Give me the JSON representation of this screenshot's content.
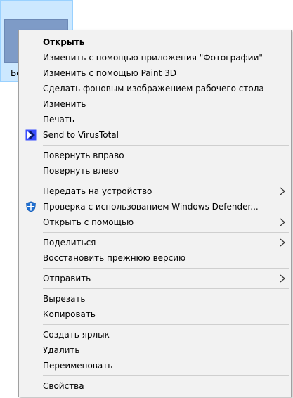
{
  "desktop": {
    "file_label": "Бе"
  },
  "menu": {
    "open": "Открыть",
    "edit_photos": "Изменить с помощью приложения \"Фотографии\"",
    "edit_paint3d": "Изменить с помощью Paint 3D",
    "set_wallpaper": "Сделать фоновым изображением рабочего стола",
    "edit": "Изменить",
    "print": "Печать",
    "virustotal": "Send to VirusTotal",
    "rotate_right": "Повернуть вправо",
    "rotate_left": "Повернуть влево",
    "cast_device": "Передать на устройство",
    "defender": "Проверка с использованием Windows Defender...",
    "open_with": "Открыть с помощью",
    "share": "Поделиться",
    "restore_previous": "Восстановить прежнюю версию",
    "send_to": "Отправить",
    "cut": "Вырезать",
    "copy": "Копировать",
    "create_shortcut": "Создать ярлык",
    "delete": "Удалить",
    "rename": "Переименовать",
    "properties": "Свойства"
  },
  "icons": {
    "virustotal": "virustotal-icon",
    "defender": "windows-defender-icon",
    "submenu": "chevron-right-icon"
  },
  "colors": {
    "menu_bg": "#f2f2f2",
    "selection_bg": "#cce8ff",
    "selection_border": "#99d1ff",
    "thumb": "#7e9bc7"
  }
}
